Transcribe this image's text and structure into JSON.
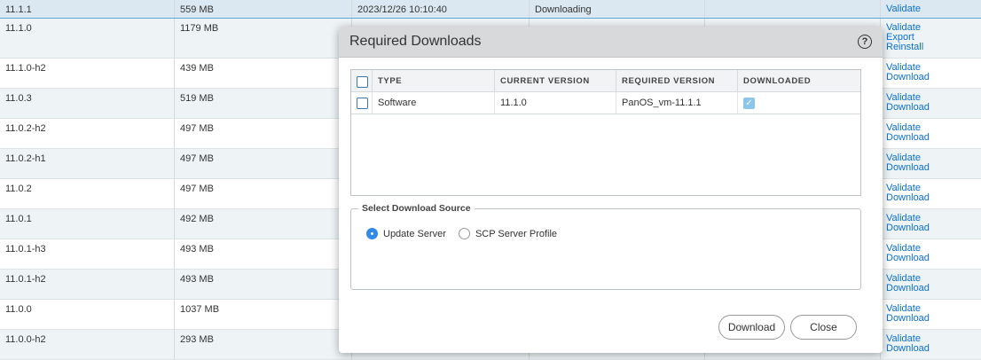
{
  "rows": [
    {
      "version": "11.1.1",
      "size": "559 MB",
      "date": "2023/12/26 10:10:40",
      "status": "Downloading",
      "actions": [
        "Validate"
      ]
    },
    {
      "version": "11.1.0",
      "size": "1179 MB",
      "actions": [
        "Validate",
        "Export",
        "Reinstall"
      ]
    },
    {
      "version": "11.1.0-h2",
      "size": "439 MB",
      "actions": [
        "Validate",
        "Download"
      ]
    },
    {
      "version": "11.0.3",
      "size": "519 MB",
      "actions": [
        "Validate",
        "Download"
      ]
    },
    {
      "version": "11.0.2-h2",
      "size": "497 MB",
      "actions": [
        "Validate",
        "Download"
      ]
    },
    {
      "version": "11.0.2-h1",
      "size": "497 MB",
      "actions": [
        "Validate",
        "Download"
      ]
    },
    {
      "version": "11.0.2",
      "size": "497 MB",
      "actions": [
        "Validate",
        "Download"
      ]
    },
    {
      "version": "11.0.1",
      "size": "492 MB",
      "actions": [
        "Validate",
        "Download"
      ]
    },
    {
      "version": "11.0.1-h3",
      "size": "493 MB",
      "actions": [
        "Validate",
        "Download"
      ]
    },
    {
      "version": "11.0.1-h2",
      "size": "493 MB",
      "actions": [
        "Validate",
        "Download"
      ]
    },
    {
      "version": "11.0.0",
      "size": "1037 MB",
      "actions": [
        "Validate",
        "Download"
      ]
    },
    {
      "version": "11.0.0-h2",
      "size": "293 MB",
      "actions": [
        "Validate",
        "Download"
      ]
    }
  ],
  "dialog": {
    "title": "Required Downloads",
    "help": "?",
    "columns": [
      "TYPE",
      "CURRENT VERSION",
      "REQUIRED VERSION",
      "DOWNLOADED"
    ],
    "items": [
      {
        "type": "Software",
        "current": "11.1.0",
        "required": "PanOS_vm-11.1.1",
        "downloaded": true
      }
    ],
    "source_legend": "Select Download Source",
    "sources": [
      {
        "label": "Update Server",
        "selected": true
      },
      {
        "label": "SCP Server Profile",
        "selected": false
      }
    ],
    "download_label": "Download",
    "close_label": "Close"
  }
}
